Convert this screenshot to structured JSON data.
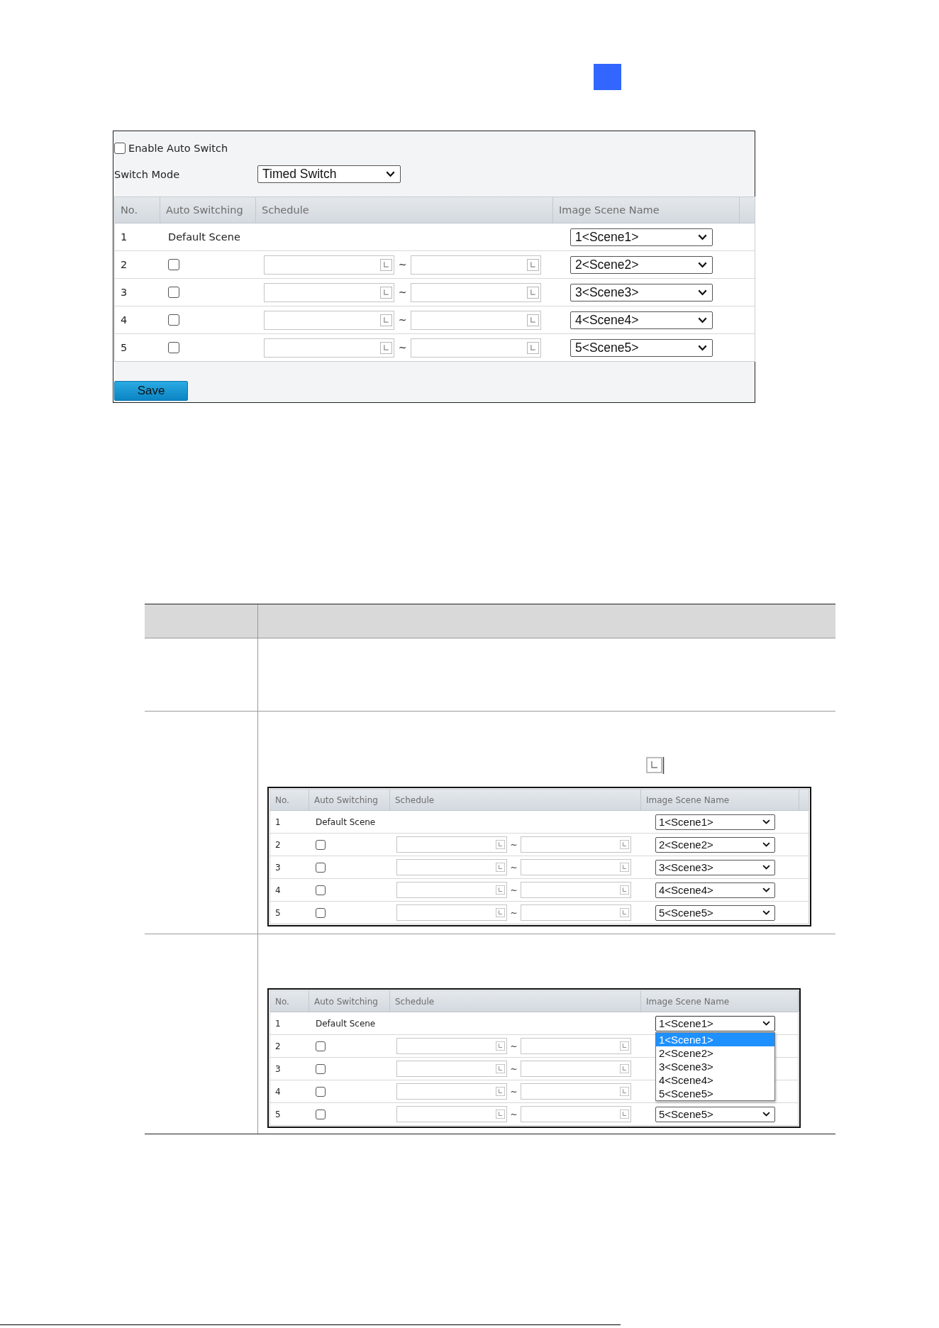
{
  "settings_panel": {
    "enable_auto_switch": {
      "label": "Enable Auto Switch",
      "checked": false
    },
    "switch_mode": {
      "label": "Switch Mode",
      "value": "Timed Switch"
    },
    "scene_table": {
      "columns": [
        "No.",
        "Auto Switching",
        "Schedule",
        "Image Scene Name"
      ],
      "rows": [
        {
          "no": "1",
          "kind": "default",
          "auto_switching": "Default Scene",
          "scene": "1<Scene1>",
          "expanded": false
        },
        {
          "no": "2",
          "kind": "timed",
          "checked": false,
          "separator": "~",
          "scene": "2<Scene2>",
          "expanded": false
        },
        {
          "no": "3",
          "kind": "timed",
          "checked": false,
          "separator": "~",
          "scene": "3<Scene3>",
          "expanded": false
        },
        {
          "no": "4",
          "kind": "timed",
          "checked": false,
          "separator": "~",
          "scene": "4<Scene4>",
          "expanded": false
        },
        {
          "no": "5",
          "kind": "timed",
          "checked": false,
          "separator": "~",
          "scene": "5<Scene5>",
          "expanded": false
        }
      ]
    },
    "save_button": "Save"
  },
  "doc_table": {
    "rows": [
      {
        "kind": "blank"
      },
      {
        "kind": "icon_figure",
        "figure": {
          "columns": [
            "No.",
            "Auto Switching",
            "Schedule",
            "Image Scene Name"
          ],
          "rows": [
            {
              "no": "1",
              "kind": "default",
              "auto_switching": "Default Scene",
              "scene": "1<Scene1>",
              "expanded": false
            },
            {
              "no": "2",
              "kind": "timed",
              "checked": false,
              "separator": "~",
              "scene": "2<Scene2>",
              "expanded": false
            },
            {
              "no": "3",
              "kind": "timed",
              "checked": false,
              "separator": "~",
              "scene": "3<Scene3>",
              "expanded": false
            },
            {
              "no": "4",
              "kind": "timed",
              "checked": false,
              "separator": "~",
              "scene": "4<Scene4>",
              "expanded": false
            },
            {
              "no": "5",
              "kind": "timed",
              "checked": false,
              "separator": "~",
              "scene": "5<Scene5>",
              "expanded": false
            }
          ]
        }
      },
      {
        "kind": "figure",
        "figure": {
          "columns": [
            "No.",
            "Auto Switching",
            "Schedule",
            "Image Scene Name"
          ],
          "rows": [
            {
              "no": "1",
              "kind": "default",
              "auto_switching": "Default Scene",
              "scene": "1<Scene1>",
              "expanded": true,
              "options": [
                {
                  "label": "1<Scene1>",
                  "selected": true
                },
                {
                  "label": "2<Scene2>",
                  "selected": false
                },
                {
                  "label": "3<Scene3>",
                  "selected": false
                },
                {
                  "label": "4<Scene4>",
                  "selected": false
                },
                {
                  "label": "5<Scene5>",
                  "selected": false
                }
              ]
            },
            {
              "no": "2",
              "kind": "timed",
              "checked": false,
              "separator": "~"
            },
            {
              "no": "3",
              "kind": "timed",
              "checked": false,
              "separator": "~"
            },
            {
              "no": "4",
              "kind": "timed",
              "checked": false,
              "separator": "~"
            },
            {
              "no": "5",
              "kind": "timed",
              "checked": false,
              "separator": "~",
              "scene": "5<Scene5>",
              "expanded": false
            }
          ]
        }
      }
    ]
  }
}
